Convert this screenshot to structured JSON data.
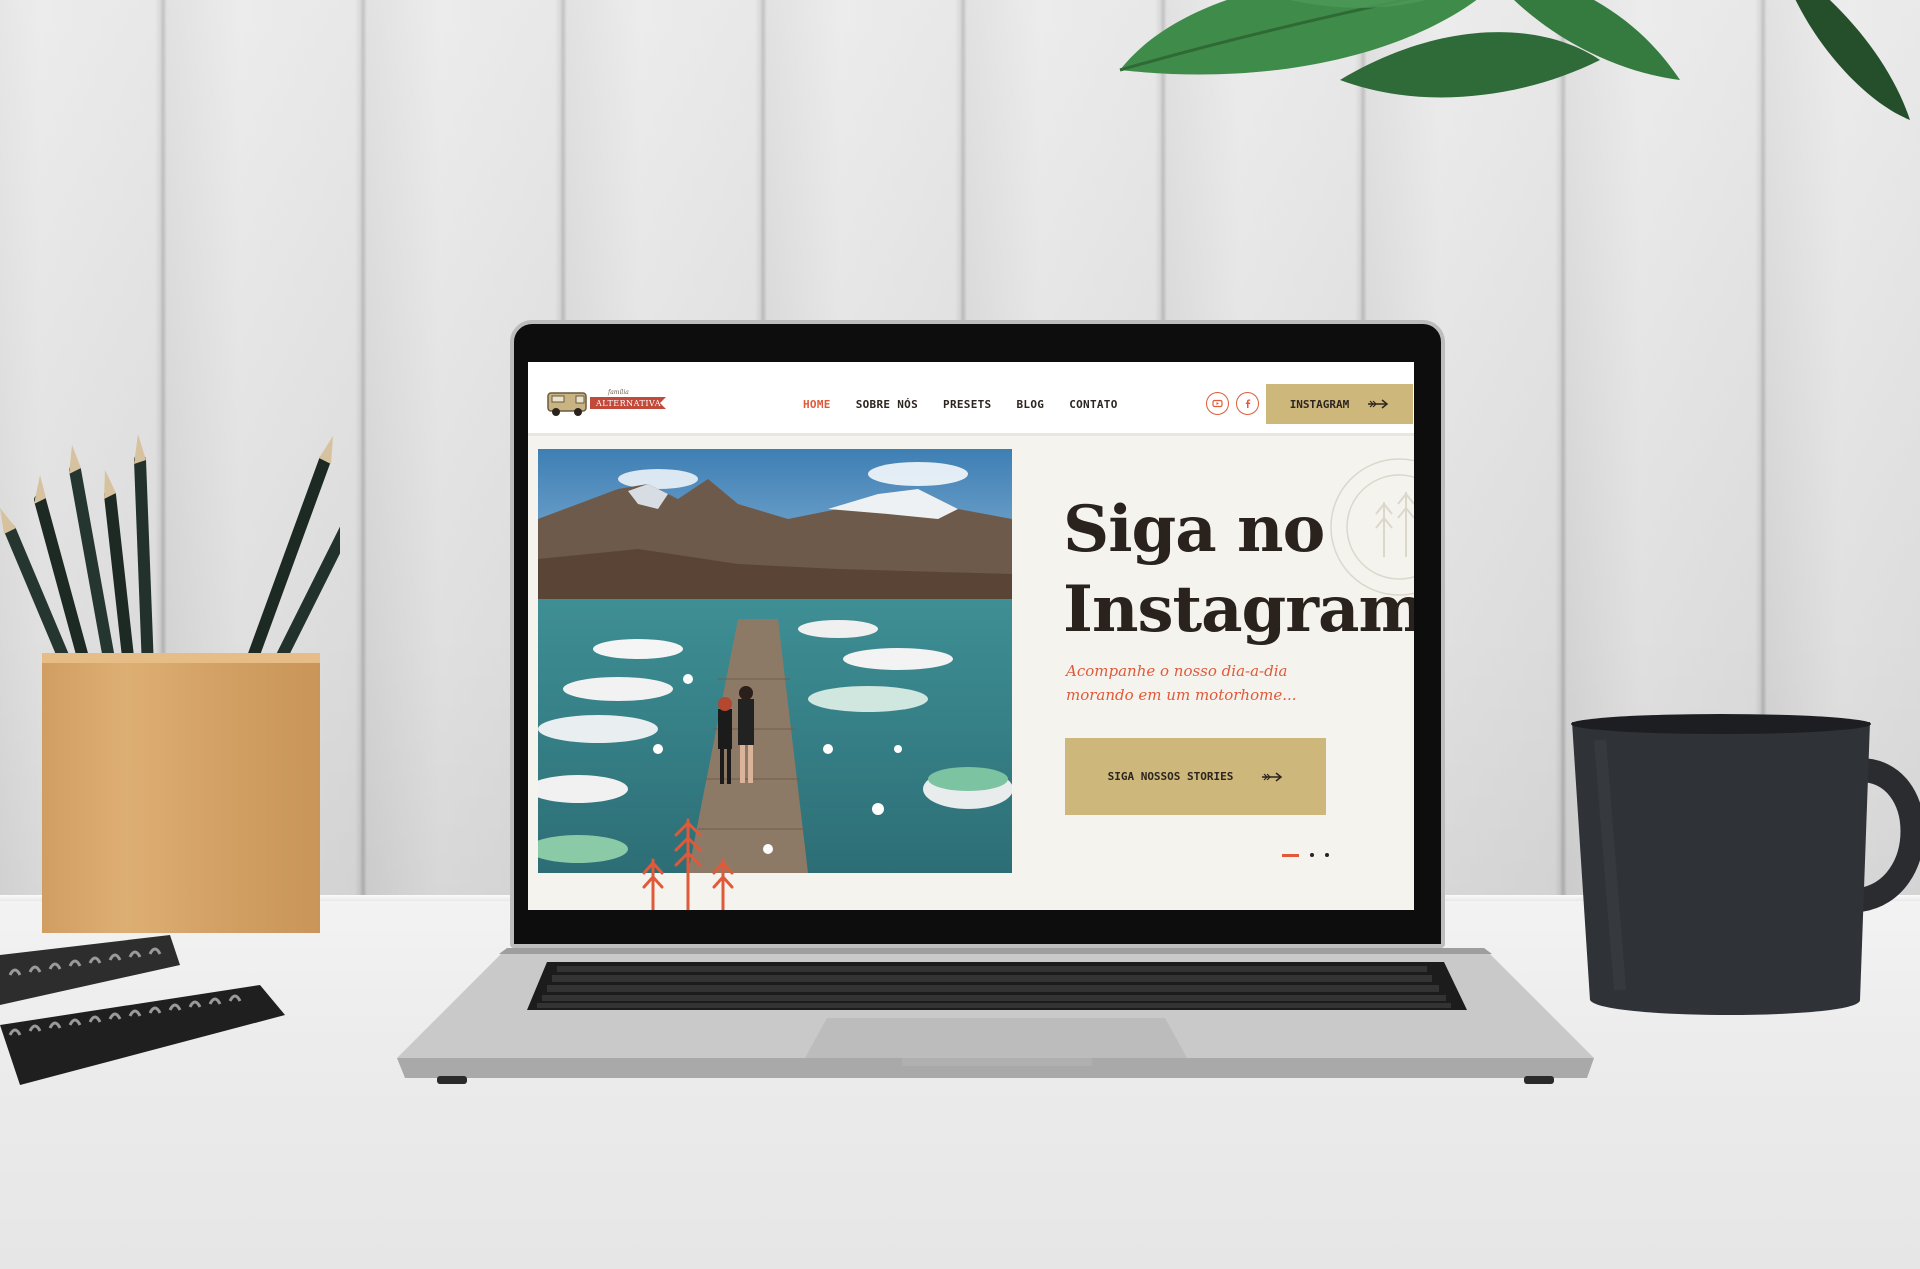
{
  "site": {
    "logo": {
      "small_text": "família",
      "banner_text": "ALTERNATIVA"
    },
    "nav": [
      {
        "label": "HOME",
        "active": true
      },
      {
        "label": "SOBRE NÓS",
        "active": false
      },
      {
        "label": "PRESETS",
        "active": false
      },
      {
        "label": "BLOG",
        "active": false
      },
      {
        "label": "CONTATO",
        "active": false
      }
    ],
    "social": [
      {
        "icon": "youtube-icon"
      },
      {
        "icon": "facebook-icon"
      }
    ],
    "header_cta": {
      "label": "INSTAGRAM",
      "icon": "arrow-right-icon"
    },
    "hero": {
      "title_line1": "Siga no",
      "title_line2": "Instagram",
      "subtitle_line1": "Acompanhe o nosso dia-a-dia",
      "subtitle_line2": "morando em um motorhome...",
      "button_label": "SIGA NOSSOS STORIES",
      "button_icon": "arrow-right-icon",
      "slide_count": 3,
      "active_slide": 1
    }
  },
  "colors": {
    "accent": "#e05a3a",
    "gold": "#cdb77b",
    "text_dark": "#2a221d",
    "page_bg": "#f5f3ee"
  }
}
